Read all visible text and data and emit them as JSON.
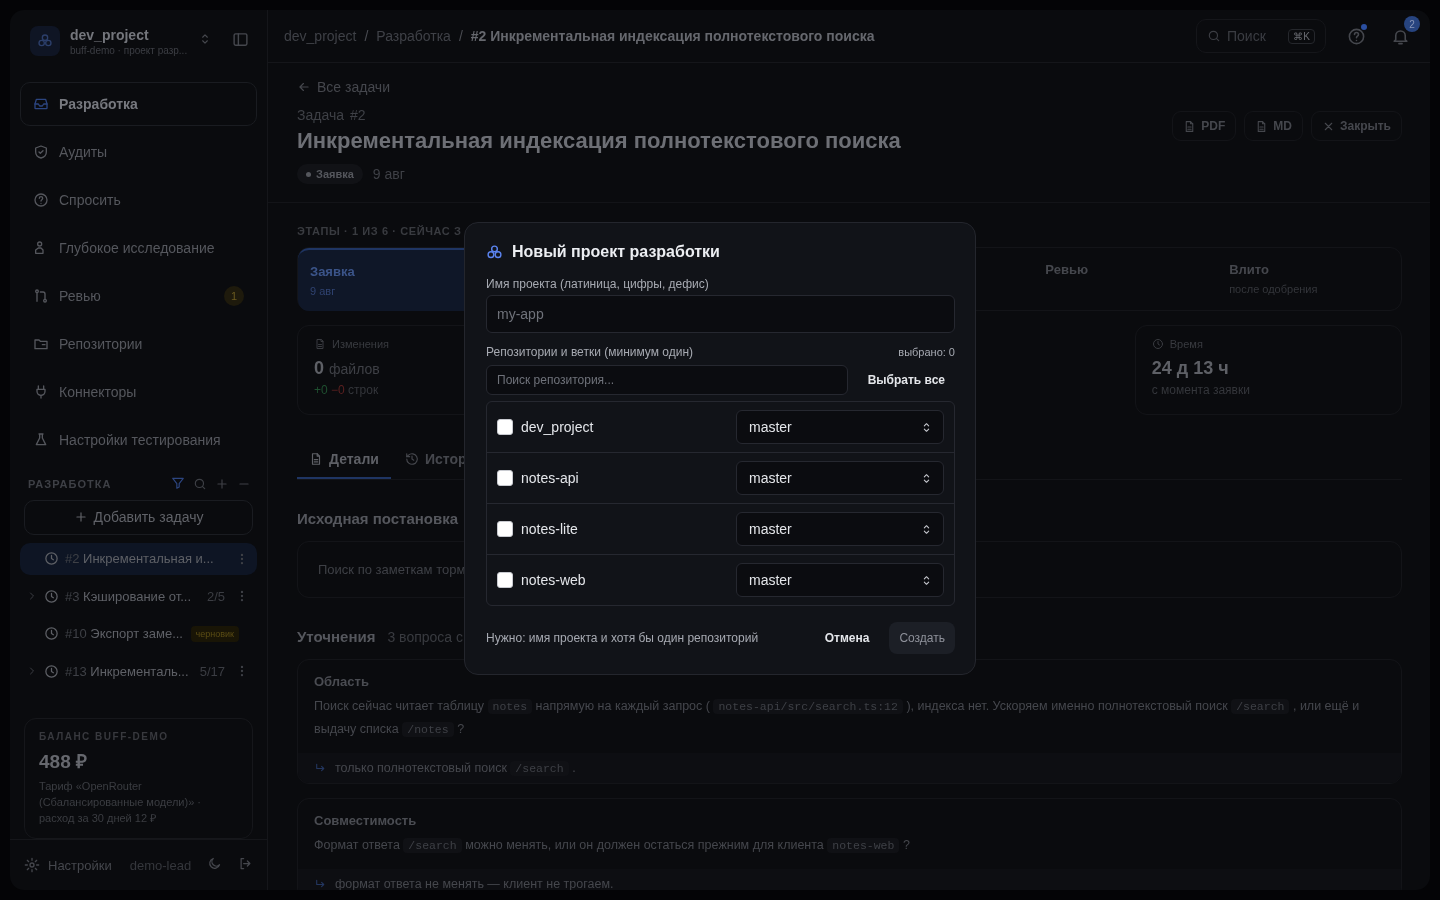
{
  "sidebar": {
    "project": {
      "name": "dev_project",
      "subtitle": "buff-demo · проект разр..."
    },
    "nav": [
      {
        "label": "Разработка",
        "selected": true
      },
      {
        "label": "Аудиты",
        "selected": false
      },
      {
        "label": "Спросить",
        "selected": false
      },
      {
        "label": "Глубокое исследование",
        "selected": false
      },
      {
        "label": "Ревью",
        "selected": false,
        "badge": "1"
      },
      {
        "label": "Репозитории",
        "selected": false
      },
      {
        "label": "Коннекторы",
        "selected": false
      },
      {
        "label": "Настройки тестирования",
        "selected": false
      }
    ],
    "section_title": "РАЗРАБОТКА",
    "add_button": "Добавить задачу",
    "tasks": [
      {
        "number": "#2",
        "title": "Инкрементальная и...",
        "selected": true,
        "expandable": false,
        "menu": true
      },
      {
        "number": "#3",
        "title": "Кэширование от...",
        "count": "2/5",
        "selected": false,
        "expandable": true,
        "menu": true
      },
      {
        "number": "#10",
        "title": "Экспорт заме...",
        "badge": "черновик",
        "selected": false,
        "expandable": false,
        "menu": false
      },
      {
        "number": "#13",
        "title": "Инкременталь...",
        "count": "5/17",
        "selected": false,
        "expandable": true,
        "menu": true
      }
    ],
    "balance": {
      "title": "БАЛАНС BUFF-DEMO",
      "amount": "488 ₽",
      "note": "Тариф «OpenRouter (Сбалансированные модели)» · расход за 30 дней 12 ₽"
    },
    "footer": {
      "settings": "Настройки",
      "user": "demo-lead"
    }
  },
  "topbar": {
    "separator": "/",
    "breadcrumbs": [
      "dev_project",
      "Разработка",
      "#2 Инкрементальная индексация полнотекстового поиска"
    ],
    "search": {
      "placeholder": "Поиск",
      "shortcut": "⌘K"
    },
    "notifications": "2"
  },
  "task": {
    "back": "Все задачи",
    "kind_label": "Задача",
    "number": "#2",
    "title": "Инкрементальная индексация полнотекстового поиска",
    "status": "Заявка",
    "date": "9 авг",
    "actions": [
      "PDF",
      "MD",
      "Закрыть"
    ],
    "stages_label": "ЭТАПЫ · 1 ИЗ 6 · СЕЙЧАС З",
    "stages": [
      {
        "name": "Заявка",
        "note": "9 авг",
        "selected": true
      },
      {
        "name": "Ревью",
        "selected": false
      },
      {
        "name": "Влито",
        "note": "после одобрения",
        "selected": false
      }
    ],
    "stats": [
      {
        "label": "Изменения",
        "value": "0",
        "unit": "файлов",
        "added": "+0",
        "removed": "−0",
        "lines": "строк"
      },
      {
        "label": "Время",
        "value": "24 д 13 ч",
        "sub": "с момента заявки"
      }
    ],
    "tabs": [
      {
        "label": "Детали",
        "selected": true
      },
      {
        "label": "Истор",
        "selected": false
      }
    ],
    "origin": {
      "title": "Исходная постановка",
      "text": "Поиск по заметкам торм"
    },
    "clarifications": {
      "title": "Уточнения",
      "count": "3 вопроса с",
      "items": [
        {
          "title": "Область",
          "question": [
            {
              "kind": "text",
              "text": "Поиск сейчас читает таблицу"
            },
            {
              "kind": "code",
              "text": "notes"
            },
            {
              "kind": "text",
              "text": "напрямую на каждый запрос ("
            },
            {
              "kind": "code",
              "text": "notes-api/src/search.ts:12"
            },
            {
              "kind": "text",
              "text": "), индекса нет. Ускоряем именно полнотекстовый поиск"
            },
            {
              "kind": "code",
              "text": "/search"
            },
            {
              "kind": "text",
              "text": ", или ещё и выдачу списка"
            },
            {
              "kind": "code",
              "text": "/notes"
            },
            {
              "kind": "text",
              "text": "?"
            }
          ],
          "answer": [
            {
              "kind": "text",
              "text": "только полнотекстовый поиск"
            },
            {
              "kind": "code",
              "text": "/search"
            },
            {
              "kind": "text",
              "text": "."
            }
          ]
        },
        {
          "title": "Совместимость",
          "question": [
            {
              "kind": "text",
              "text": "Формат ответа"
            },
            {
              "kind": "code",
              "text": "/search"
            },
            {
              "kind": "text",
              "text": "можно менять, или он должен остаться прежним для клиента"
            },
            {
              "kind": "code",
              "text": "notes-web"
            },
            {
              "kind": "text",
              "text": "?"
            }
          ],
          "answer": [
            {
              "kind": "text",
              "text": "формат ответа не менять — клиент не трогаем."
            }
          ]
        }
      ]
    }
  },
  "dialog": {
    "title": "Новый проект разработки",
    "name_label": "Имя проекта (латиница, цифры, дефис)",
    "name_placeholder": "my-app",
    "repos_label": "Репозитории и ветки (минимум один)",
    "selected_count": "выбрано: 0",
    "repo_search_placeholder": "Поиск репозитория...",
    "select_all": "Выбрать все",
    "repos": [
      {
        "name": "dev_project",
        "checked": false,
        "branch": "master"
      },
      {
        "name": "notes-api",
        "checked": false,
        "branch": "master"
      },
      {
        "name": "notes-lite",
        "checked": false,
        "branch": "master"
      },
      {
        "name": "notes-web",
        "checked": false,
        "branch": "master"
      }
    ],
    "hint": "Нужно: имя проекта и хотя бы один репозиторий",
    "cancel": "Отмена",
    "create": {
      "label": "Создать",
      "disabled": true
    }
  }
}
